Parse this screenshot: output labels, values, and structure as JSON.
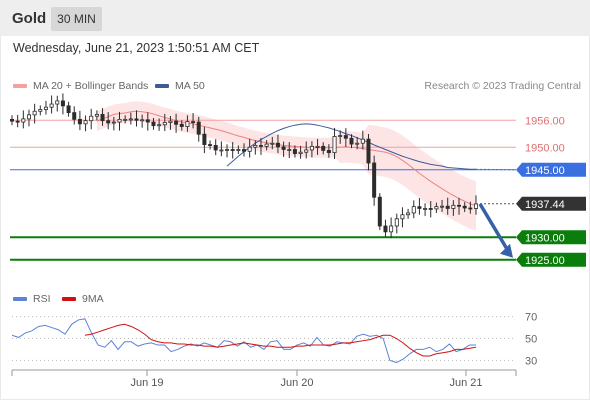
{
  "header": {
    "title": "Gold",
    "timeframe": "30 MIN"
  },
  "datetime": "Wednesday, June 21, 2023 1:50:51 AM CET",
  "legend": {
    "ma20_label": "MA 20 + Bollinger Bands",
    "ma50_label": "MA 50",
    "copyright": "Research © 2023 Trading Central",
    "rsi_label": "RSI",
    "rsi_ma_label": "9MA"
  },
  "colors": {
    "ma20": "#f08080",
    "ma50": "#3d5a99",
    "bollinger": "#fde0e0",
    "resistance": "#e07070",
    "pivot": "#3a6fe0",
    "support": "#0a7d0a",
    "arrow": "#3660a8",
    "candle": "#2c2c2c"
  },
  "chart_data": [
    {
      "type": "candlestick",
      "title": "Gold",
      "timeframe": "30 MIN",
      "x_ticks": [
        "Jun 19",
        "Jun 20",
        "Jun 21"
      ],
      "ylim": [
        1920.5,
        1960.5
      ],
      "levels": [
        {
          "label": "1956.00",
          "value": 1956.0,
          "kind": "resistance"
        },
        {
          "label": "1950.00",
          "value": 1950.0,
          "kind": "resistance"
        },
        {
          "label": "1945.00",
          "value": 1945.0,
          "kind": "pivot"
        },
        {
          "label": "1930.00",
          "value": 1930.0,
          "kind": "support"
        },
        {
          "label": "1925.00",
          "value": 1925.0,
          "kind": "support"
        }
      ],
      "last_price": {
        "label": "1937.44",
        "value": 1937.44
      },
      "forecast_arrow": {
        "from": 1937.4,
        "to": 1925.0
      },
      "close": [
        1955.8,
        1955.6,
        1956.3,
        1957.2,
        1958.0,
        1958.4,
        1958.9,
        1959.6,
        1960.3,
        1959.2,
        1957.7,
        1956.2,
        1955.2,
        1955.9,
        1956.9,
        1957.3,
        1955.9,
        1955.4,
        1955.6,
        1956.2,
        1956.2,
        1956.3,
        1956.0,
        1956.1,
        1955.6,
        1954.8,
        1955.0,
        1955.5,
        1955.8,
        1955.1,
        1954.6,
        1955.7,
        1955.6,
        1952.9,
        1950.6,
        1950.4,
        1949.4,
        1949.4,
        1949.5,
        1949.4,
        1949.5,
        1949.1,
        1950.0,
        1950.4,
        1950.2,
        1950.7,
        1950.9,
        1950.1,
        1949.5,
        1949.5,
        1948.6,
        1948.9,
        1949.4,
        1950.2,
        1950.2,
        1949.3,
        1948.8,
        1952.4,
        1952.6,
        1952.0,
        1950.7,
        1950.9,
        1951.8,
        1946.5,
        1938.9,
        1932.5,
        1931.2,
        1932.5,
        1934.1,
        1935.0,
        1935.4,
        1936.8,
        1936.4,
        1936.4,
        1936.3,
        1936.8,
        1936.9,
        1936.4,
        1937.1,
        1936.9,
        1936.5,
        1936.4,
        1937.4
      ],
      "ma20": [
        1955.8,
        1956.3,
        1956.8,
        1957.3,
        1957.5,
        1957.6,
        1957.9,
        1958.0,
        1957.9,
        1957.7,
        1957.4,
        1957.0,
        1956.6,
        1956.3,
        1955.9,
        1955.6,
        1955.4,
        1955.2,
        1954.9,
        1954.6,
        1954.3,
        1954.0,
        1953.7,
        1953.3,
        1952.9,
        1952.5,
        1952.2,
        1951.8,
        1951.5,
        1951.2,
        1951.0,
        1950.8,
        1950.6,
        1950.4,
        1950.3,
        1950.2,
        1950.1,
        1950.0,
        1949.9,
        1949.9,
        1949.9,
        1949.9,
        1950.0,
        1950.0,
        1950.1,
        1950.0,
        1949.9,
        1949.7,
        1949.5,
        1949.3,
        1949.1,
        1948.9,
        1948.5,
        1947.9,
        1947.1,
        1946.2,
        1945.2,
        1944.2,
        1943.3,
        1942.4,
        1941.6,
        1940.8,
        1940.0,
        1939.3,
        1938.6,
        1938.0,
        1937.4,
        1937.0
      ],
      "ma50": [
        1945.8,
        1946.9,
        1948.0,
        1949.0,
        1950.0,
        1950.9,
        1951.7,
        1952.4,
        1953.1,
        1953.7,
        1954.2,
        1954.6,
        1954.9,
        1955.1,
        1955.2,
        1955.1,
        1954.9,
        1954.6,
        1954.3,
        1953.9,
        1953.5,
        1953.0,
        1952.6,
        1952.1,
        1951.6,
        1951.1,
        1950.5,
        1950.0,
        1949.5,
        1949.0,
        1948.5,
        1948.0,
        1947.6,
        1947.2,
        1946.8,
        1946.5,
        1946.2,
        1946.0,
        1945.8,
        1945.5,
        1945.4,
        1945.3,
        1945.2,
        1945.1,
        1945.1
      ]
    },
    {
      "type": "line",
      "title": "RSI",
      "series": [
        {
          "name": "RSI",
          "values": [
            53,
            51,
            55,
            57,
            61,
            62,
            60,
            58,
            54,
            63,
            67,
            68,
            55,
            44,
            42,
            48,
            40,
            47,
            47,
            43,
            45,
            46,
            44,
            44,
            38,
            40,
            43,
            45,
            43,
            46,
            44,
            42,
            48,
            47,
            43,
            47,
            42,
            44,
            40,
            47,
            48,
            40,
            40,
            44,
            46,
            43,
            51,
            44,
            43,
            47,
            46,
            45,
            52,
            54,
            52,
            53,
            50,
            30,
            28,
            31,
            36,
            40,
            40,
            42,
            38,
            40,
            45,
            38,
            40,
            44,
            44
          ]
        },
        {
          "name": "9MA",
          "values": [
            53,
            54,
            56,
            58,
            60,
            62,
            63,
            61,
            58,
            54,
            49,
            47,
            46,
            46,
            45,
            45,
            44,
            44,
            43,
            43,
            42,
            43,
            44,
            45,
            46,
            45,
            44,
            43,
            43,
            42,
            42,
            42,
            43,
            43,
            44,
            44,
            44,
            44,
            45,
            46,
            46,
            47,
            48,
            49,
            51,
            53,
            53,
            50,
            46,
            41,
            37,
            34,
            34,
            36,
            37,
            38,
            40,
            40,
            41,
            42
          ]
        }
      ],
      "ylim": [
        23,
        77
      ],
      "y_ticks": [
        70,
        50,
        30
      ],
      "guides": [
        70,
        50,
        30
      ]
    }
  ]
}
